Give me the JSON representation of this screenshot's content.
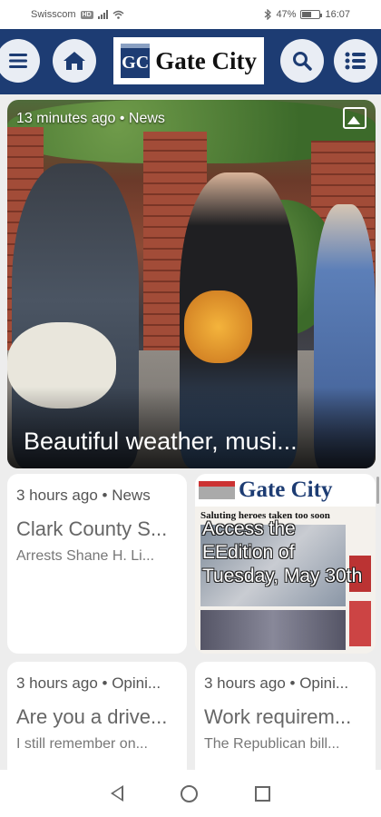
{
  "status_bar": {
    "carrier": "Swisscom",
    "carrier_badge": "HD",
    "battery": "47%",
    "time": "16:07"
  },
  "header": {
    "logo_mark": "GC",
    "logo_text": "Gate City",
    "icons": [
      "menu-icon",
      "home-icon",
      "search-icon",
      "sections-list-icon"
    ],
    "accent_color": "#1d3c73"
  },
  "hero": {
    "meta": "13 minutes ago • News",
    "title": "Beautiful weather, musi..."
  },
  "cards": [
    {
      "meta": "3 hours ago • News",
      "title": "Clark County S...",
      "snippet": "Arrests Shane H. Li..."
    },
    {
      "meta": "3 hours ago • Opini...",
      "title": "Are you a drive...",
      "snippet": "I still remember on..."
    },
    {
      "meta": "3 hours ago • Opini...",
      "title": "Work requirem...",
      "snippet": "The Republican bill..."
    }
  ],
  "eedition": {
    "overlay_text": "Access the EEdition of Tuesday, May 30th",
    "paper_name": "Gate City",
    "paper_headline": "Saluting heroes taken too soon"
  }
}
